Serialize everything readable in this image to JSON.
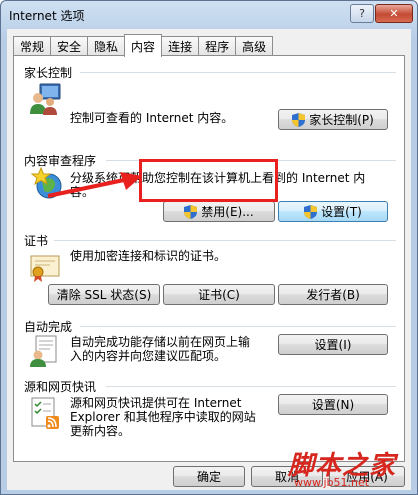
{
  "window": {
    "title": "Internet 选项",
    "help_label": "?",
    "close_label": "✕"
  },
  "tabs": [
    "常规",
    "安全",
    "隐私",
    "内容",
    "连接",
    "程序",
    "高级"
  ],
  "active_tab": 3,
  "parental": {
    "title": "家长控制",
    "desc": "控制可查看的 Internet 内容。",
    "button": "家长控制(P)"
  },
  "advisor": {
    "title": "内容审查程序",
    "desc_line1": "分级系统可帮助您控制在该计算机上看到的 Internet 内",
    "desc_line2": "容。",
    "disable_button": "禁用(E)...",
    "settings_button": "设置(T)"
  },
  "certificates": {
    "title": "证书",
    "desc": "使用加密连接和标识的证书。",
    "clear_ssl_button": "清除 SSL 状态(S)",
    "certs_button": "证书(C)",
    "publishers_button": "发行者(B)"
  },
  "autocomplete": {
    "title": "自动完成",
    "desc_line1": "自动完成功能存储以前在网页上输",
    "desc_line2": "入的内容并向您建议匹配项。",
    "settings_button": "设置(I)"
  },
  "feeds": {
    "title": "源和网页快讯",
    "desc_line1": "源和网页快讯提供可在 Internet",
    "desc_line2": "Explorer 和其他程序中读取的网站",
    "desc_line3": "更新内容。",
    "settings_button": "设置(N)"
  },
  "footer": {
    "ok_button": "确定",
    "cancel_button": "取消",
    "apply_button": "应用(A)"
  },
  "watermark": {
    "brand": "脚本之家",
    "url": "www.jb51.net"
  },
  "colors": {
    "annotation_red": "#e8201e",
    "watermark_red": "#d7261e"
  }
}
